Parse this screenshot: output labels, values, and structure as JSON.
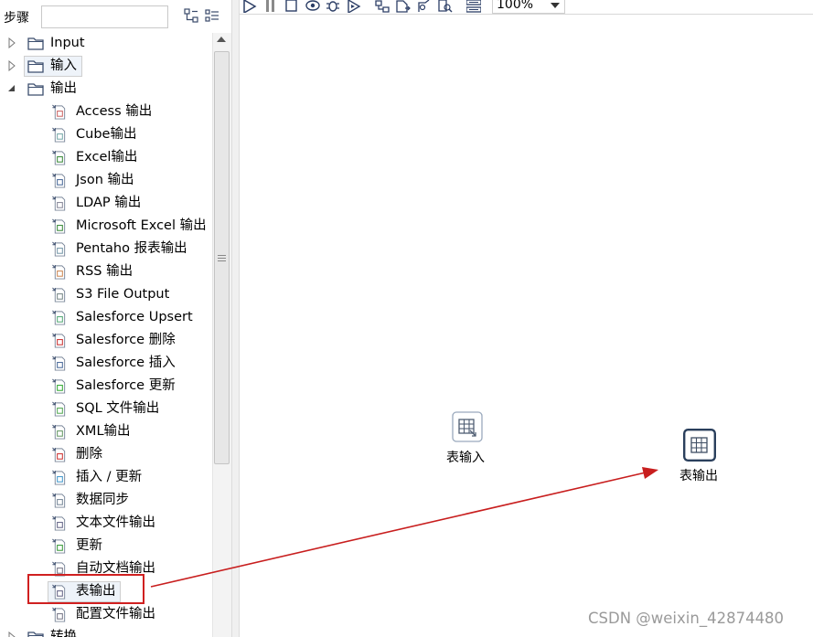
{
  "steps_panel": {
    "title": "步骤",
    "search": {
      "value": "",
      "placeholder": ""
    }
  },
  "tree": {
    "folders": [
      {
        "label": "Input",
        "expanded": false
      },
      {
        "label": "输入",
        "expanded": false,
        "selected": true
      },
      {
        "label": "输出",
        "expanded": true
      },
      {
        "label": "转换",
        "expanded": false
      }
    ],
    "output_items": [
      {
        "label": "Access 输出",
        "icon": "access-output-icon"
      },
      {
        "label": "Cube输出",
        "icon": "cube-output-icon"
      },
      {
        "label": "Excel输出",
        "icon": "excel-output-icon"
      },
      {
        "label": "Json 输出",
        "icon": "json-output-icon"
      },
      {
        "label": "LDAP 输出",
        "icon": "ldap-output-icon"
      },
      {
        "label": "Microsoft Excel 输出",
        "icon": "ms-excel-output-icon"
      },
      {
        "label": "Pentaho 报表输出",
        "icon": "pentaho-report-icon"
      },
      {
        "label": "RSS 输出",
        "icon": "rss-output-icon"
      },
      {
        "label": "S3 File Output",
        "icon": "s3-output-icon"
      },
      {
        "label": "Salesforce Upsert",
        "icon": "salesforce-upsert-icon"
      },
      {
        "label": "Salesforce 删除",
        "icon": "salesforce-delete-icon"
      },
      {
        "label": "Salesforce 插入",
        "icon": "salesforce-insert-icon"
      },
      {
        "label": "Salesforce 更新",
        "icon": "salesforce-update-icon"
      },
      {
        "label": "SQL 文件输出",
        "icon": "sql-file-output-icon"
      },
      {
        "label": "XML输出",
        "icon": "xml-output-icon"
      },
      {
        "label": "删除",
        "icon": "delete-icon"
      },
      {
        "label": "插入 / 更新",
        "icon": "insert-update-icon"
      },
      {
        "label": "数据同步",
        "icon": "data-sync-icon"
      },
      {
        "label": "文本文件输出",
        "icon": "text-file-output-icon"
      },
      {
        "label": "更新",
        "icon": "update-icon"
      },
      {
        "label": "自动文档输出",
        "icon": "auto-doc-output-icon"
      },
      {
        "label": "表输出",
        "icon": "table-output-icon"
      },
      {
        "label": "配置文件输出",
        "icon": "config-file-output-icon"
      }
    ]
  },
  "toolbar": {
    "zoom": "100%",
    "icons": [
      "run-icon",
      "pause-icon",
      "stop-icon",
      "preview-icon",
      "debug-icon",
      "replay-icon",
      "verify-icon",
      "impact-icon",
      "sql-icon",
      "explore-db-icon",
      "show-results-icon"
    ]
  },
  "canvas": {
    "steps": [
      {
        "label": "表输入"
      },
      {
        "label": "表输出"
      }
    ]
  },
  "annotation": {
    "color": "#c81e1e"
  },
  "watermark": "CSDN @weixin_42874480"
}
